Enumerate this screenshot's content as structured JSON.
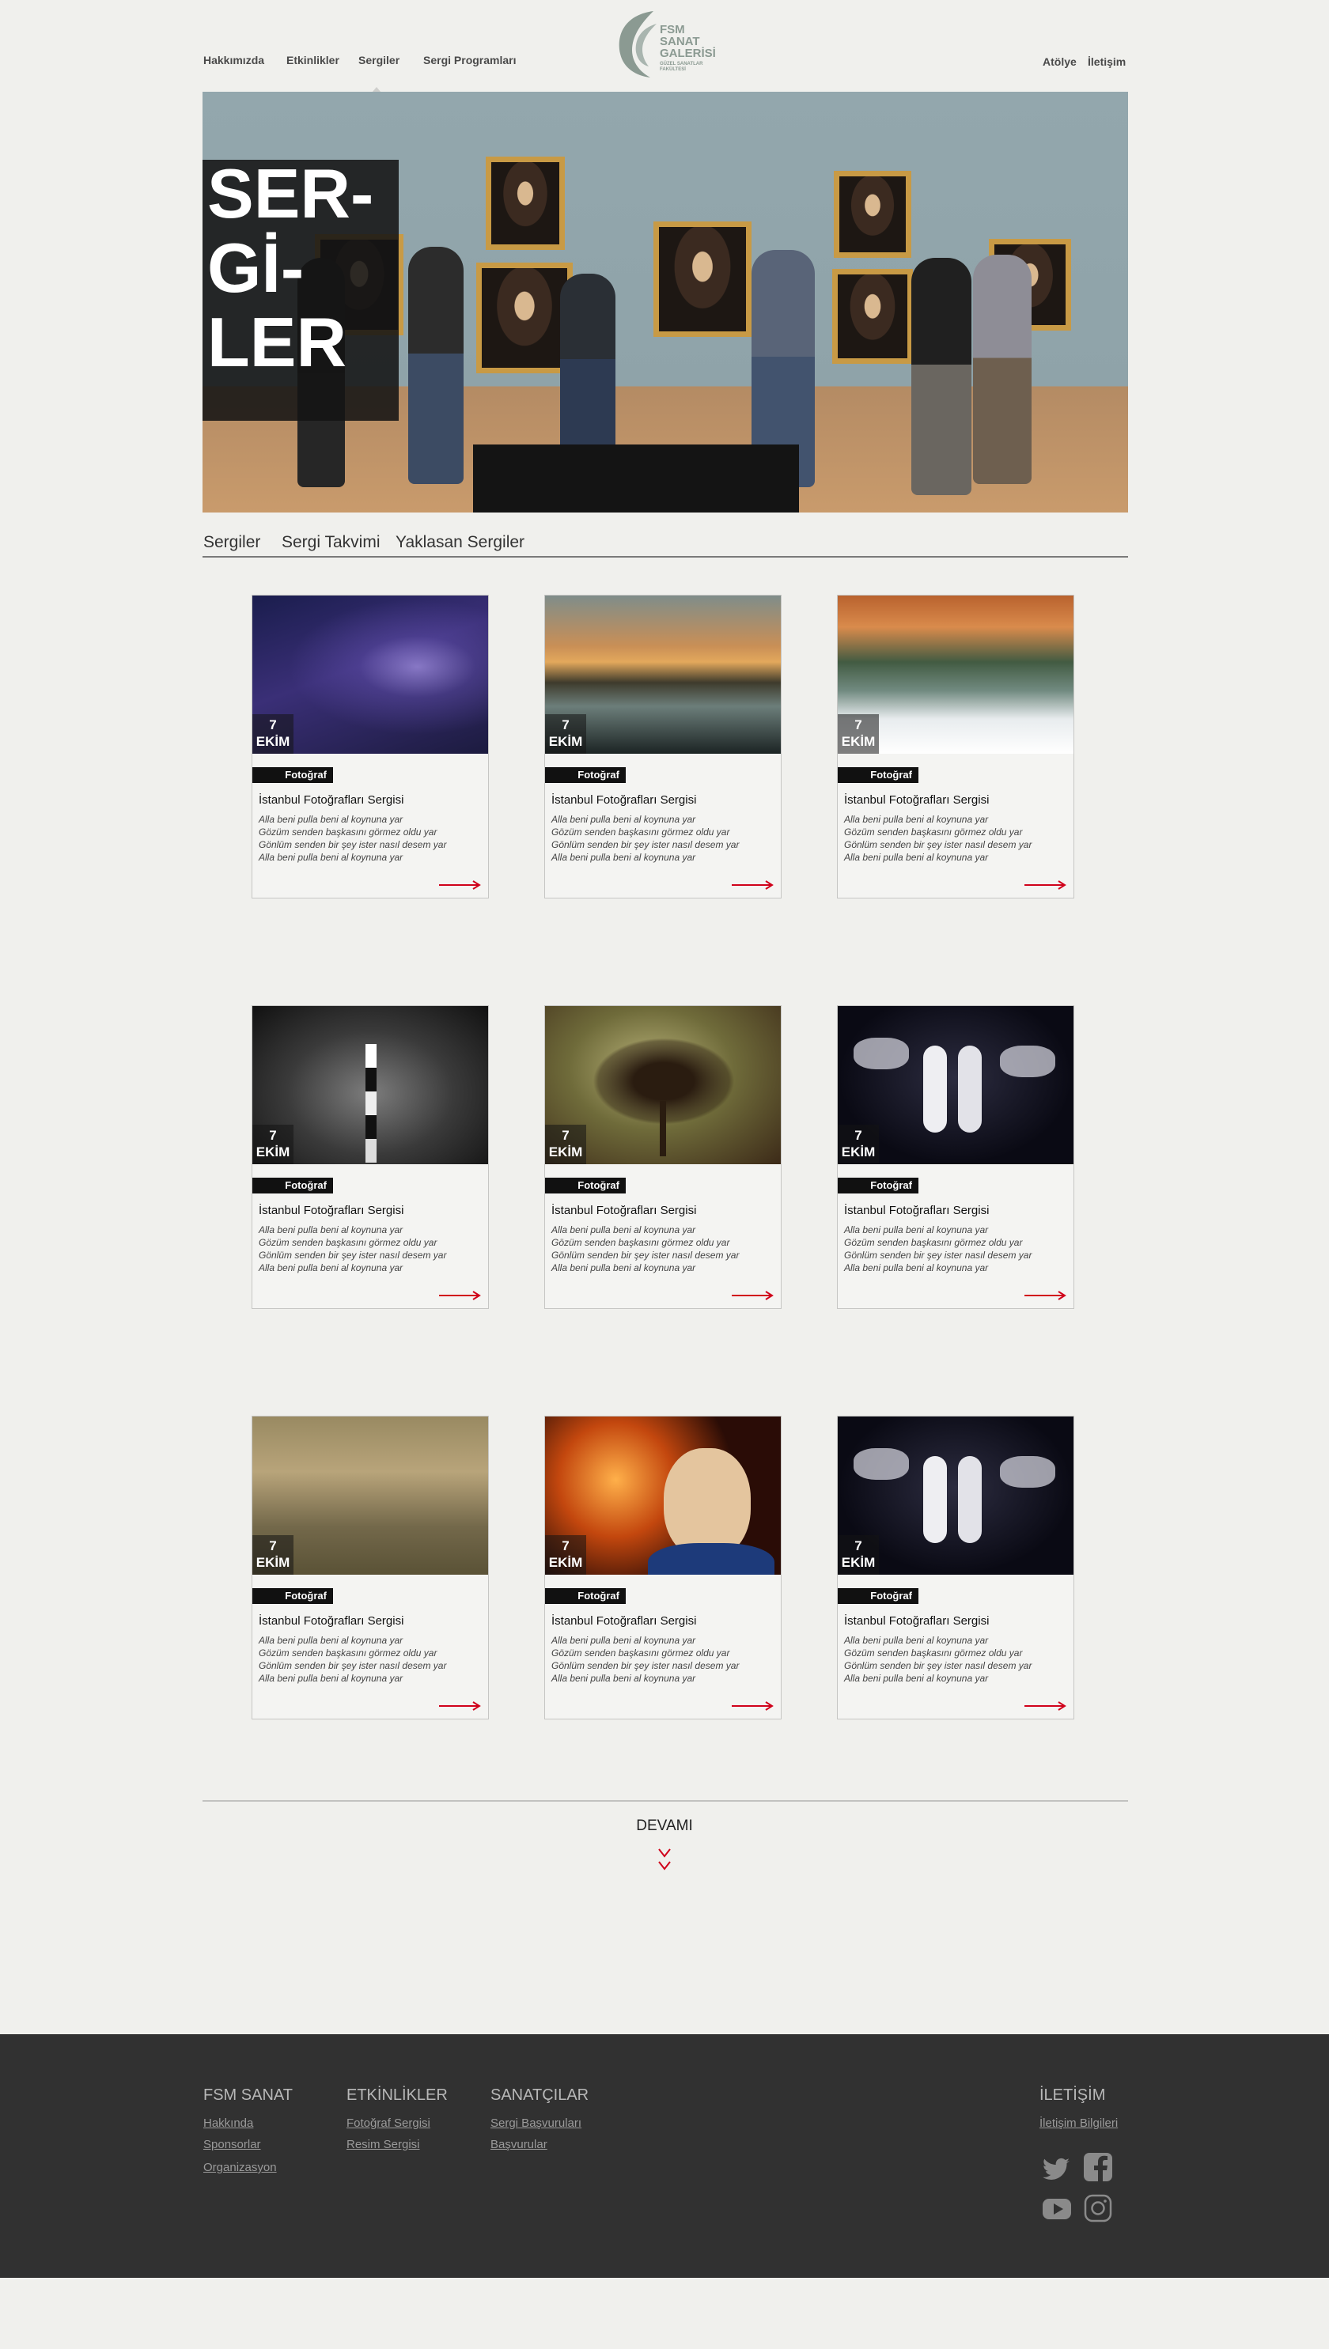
{
  "header": {
    "nav_left": [
      "Hakkımızda",
      "Etkinlikler",
      "Sergiler",
      "Sergi Programları"
    ],
    "nav_right": [
      "Atölye",
      "İletişim"
    ],
    "active_nav": "Sergiler",
    "logo": {
      "lines": [
        "FSM",
        "SANAT",
        "GALERİSİ"
      ],
      "sub": [
        "GÜZEL SANATLAR",
        "FAKÜLTESİ"
      ]
    }
  },
  "hero": {
    "title_lines": [
      "SER-",
      "Gİ-",
      "LER"
    ]
  },
  "tabs": [
    "Sergiler",
    "Sergi Takvimi",
    "Yaklasan Sergiler"
  ],
  "cards": [
    {
      "image": "milky-way-night-sky",
      "day": "7",
      "month": "EKİM",
      "category": "Fotoğraf",
      "title": "İstanbul Fotoğrafları Sergisi",
      "desc": [
        "Alla beni pulla beni al koynuna yar",
        "Gözüm senden başkasını görmez oldu yar",
        "Gönlüm senden bir şey ister nasıl desem yar",
        "Alla beni pulla beni al koynuna yar"
      ]
    },
    {
      "image": "sunset-river-painting",
      "day": "7",
      "month": "EKİM",
      "category": "Fotoğraf",
      "title": "İstanbul Fotoğrafları Sergisi",
      "desc": [
        "Alla beni pulla beni al koynuna yar",
        "Gözüm senden başkasını görmez oldu yar",
        "Gönlüm senden bir şey ister nasıl desem yar",
        "Alla beni pulla beni al koynuna yar"
      ]
    },
    {
      "image": "autumn-pagoda-pond",
      "day": "7",
      "month": "EKİM",
      "category": "Fotoğraf",
      "title": "İstanbul Fotoğrafları Sergisi",
      "desc": [
        "Alla beni pulla beni al koynuna yar",
        "Gözüm senden başkasını görmez oldu yar",
        "Gönlüm senden bir şey ister nasıl desem yar",
        "Alla beni pulla beni al koynuna yar"
      ]
    },
    {
      "image": "lighthouse-storm",
      "day": "7",
      "month": "EKİM",
      "category": "Fotoğraf",
      "title": "İstanbul Fotoğrafları Sergisi",
      "desc": [
        "Alla beni pulla beni al koynuna yar",
        "Gözüm senden başkasını görmez oldu yar",
        "Gönlüm senden bir şey ister nasıl desem yar",
        "Alla beni pulla beni al koynuna yar"
      ]
    },
    {
      "image": "lone-tree-textured",
      "day": "7",
      "month": "EKİM",
      "category": "Fotoğraf",
      "title": "İstanbul Fotoğrafları Sergisi",
      "desc": [
        "Alla beni pulla beni al koynuna yar",
        "Gözüm senden başkasını görmez oldu yar",
        "Gönlüm senden bir şey ister nasıl desem yar",
        "Alla beni pulla beni al koynuna yar"
      ]
    },
    {
      "image": "dancers-sculpture",
      "day": "7",
      "month": "EKİM",
      "category": "Fotoğraf",
      "title": "İstanbul Fotoğrafları Sergisi",
      "desc": [
        "Alla beni pulla beni al koynuna yar",
        "Gözüm senden başkasını görmez oldu yar",
        "Gönlüm senden bir şey ister nasıl desem yar",
        "Alla beni pulla beni al koynuna yar"
      ]
    },
    {
      "image": "classical-painting-figures",
      "day": "7",
      "month": "EKİM",
      "category": "Fotoğraf",
      "title": "İstanbul Fotoğrafları Sergisi",
      "desc": [
        "Alla beni pulla beni al koynuna yar",
        "Gözüm senden başkasını görmez oldu yar",
        "Gönlüm senden bir şey ister nasıl desem yar",
        "Alla beni pulla beni al koynuna yar"
      ]
    },
    {
      "image": "portrait-fiery-sphere",
      "day": "7",
      "month": "EKİM",
      "category": "Fotoğraf",
      "title": "İstanbul Fotoğrafları Sergisi",
      "desc": [
        "Alla beni pulla beni al koynuna yar",
        "Gözüm senden başkasını görmez oldu yar",
        "Gönlüm senden bir şey ister nasıl desem yar",
        "Alla beni pulla beni al koynuna yar"
      ]
    },
    {
      "image": "dancers-sculpture",
      "day": "7",
      "month": "EKİM",
      "category": "Fotoğraf",
      "title": "İstanbul Fotoğrafları Sergisi",
      "desc": [
        "Alla beni pulla beni al koynuna yar",
        "Gözüm senden başkasını görmez oldu yar",
        "Gönlüm senden bir şey ister nasıl desem yar",
        "Alla beni pulla beni al koynuna yar"
      ]
    }
  ],
  "more": {
    "label": "DEVAMI"
  },
  "footer": {
    "columns": [
      {
        "heading": "FSM SANAT",
        "links": [
          "Hakkında",
          "Sponsorlar",
          "Organizasyon"
        ]
      },
      {
        "heading": "ETKİNLİKLER",
        "links": [
          "Fotoğraf Sergisi",
          "Resim Sergisi"
        ]
      },
      {
        "heading": "SANATÇILAR",
        "links": [
          "Sergi Başvuruları",
          "Başvurular"
        ]
      },
      {
        "heading": "İLETİŞİM",
        "links": [
          "İletişim Bilgileri"
        ]
      }
    ],
    "social": [
      "twitter-icon",
      "facebook-icon",
      "youtube-icon",
      "instagram-icon"
    ]
  },
  "colors": {
    "accent_red": "#d0021b",
    "logo_green": "#8b9a92",
    "footer_bg": "#313131",
    "page_bg": "#f0f0ed"
  }
}
